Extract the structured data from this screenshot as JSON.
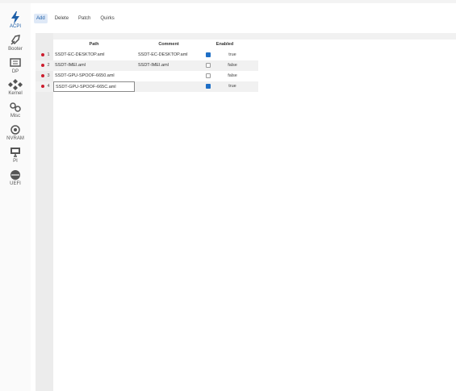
{
  "sidebar": {
    "items": [
      {
        "label": "ACPI",
        "icon": "bolt-icon",
        "active": true
      },
      {
        "label": "Booter",
        "icon": "boot-icon"
      },
      {
        "label": "DP",
        "icon": "display-icon"
      },
      {
        "label": "Kernel",
        "icon": "kernel-icon"
      },
      {
        "label": "Misc",
        "icon": "misc-icon"
      },
      {
        "label": "NVRAM",
        "icon": "nvram-icon"
      },
      {
        "label": "PI",
        "icon": "monitor-icon"
      },
      {
        "label": "UEFI",
        "icon": "uefi-icon"
      }
    ]
  },
  "tabs": [
    {
      "label": "Add",
      "active": true
    },
    {
      "label": "Delete"
    },
    {
      "label": "Patch"
    },
    {
      "label": "Quirks"
    }
  ],
  "table": {
    "headers": {
      "path": "Path",
      "comment": "Comment",
      "enabled": "Enabled"
    },
    "rows": [
      {
        "num": "1",
        "path": "SSDT-EC-DESKTOP.aml",
        "comment": "SSDT-EC-DESKTOP.aml",
        "enabled": true,
        "value": "true"
      },
      {
        "num": "2",
        "path": "SSDT-IMEI.aml",
        "comment": "SSDT-IMEI.aml",
        "enabled": false,
        "value": "false"
      },
      {
        "num": "3",
        "path": "SSDT-GPU-SPOOF-6650.aml",
        "comment": "",
        "enabled": false,
        "value": "false"
      },
      {
        "num": "4",
        "path": "SSDT-GPU-SPOOF-665C.aml",
        "comment": "",
        "enabled": true,
        "value": "true"
      }
    ]
  },
  "colors": {
    "accent": "#1e5fa8",
    "bullet": "#cc1d2e",
    "checked": "#1f6fc6"
  }
}
